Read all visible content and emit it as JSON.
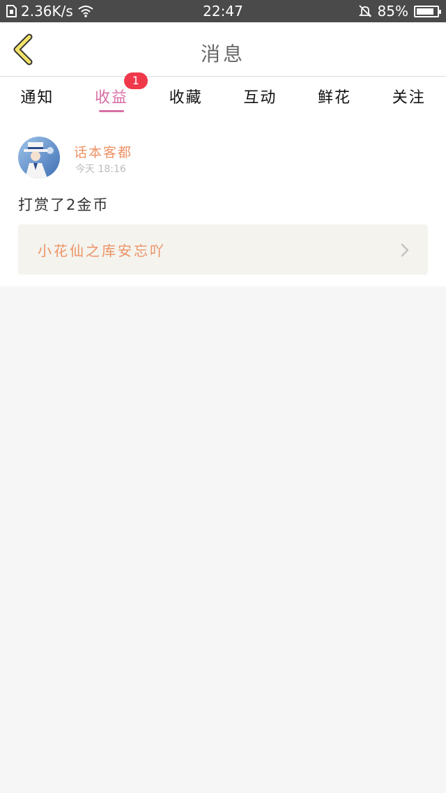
{
  "status_bar": {
    "net_speed": "2.36K/s",
    "time": "22:47",
    "battery_percent": "85%",
    "battery_level": 0.85
  },
  "header": {
    "title": "消息",
    "back_icon": "chevron-left-icon"
  },
  "tabs": [
    {
      "label": "通知"
    },
    {
      "label": "收益",
      "badge": "1",
      "active": true
    },
    {
      "label": "收藏"
    },
    {
      "label": "互动"
    },
    {
      "label": "鲜花"
    },
    {
      "label": "关注"
    }
  ],
  "message_card": {
    "username": "话本客都",
    "timestamp": "今天 18:16",
    "text": "打赏了2金币",
    "link_text": "小花仙之库安忘吖"
  },
  "colors": {
    "accent_pink": "#d86fa6",
    "accent_orange": "#ec9264",
    "badge_red": "#f0384b",
    "back_arrow": "#f3e36a"
  }
}
